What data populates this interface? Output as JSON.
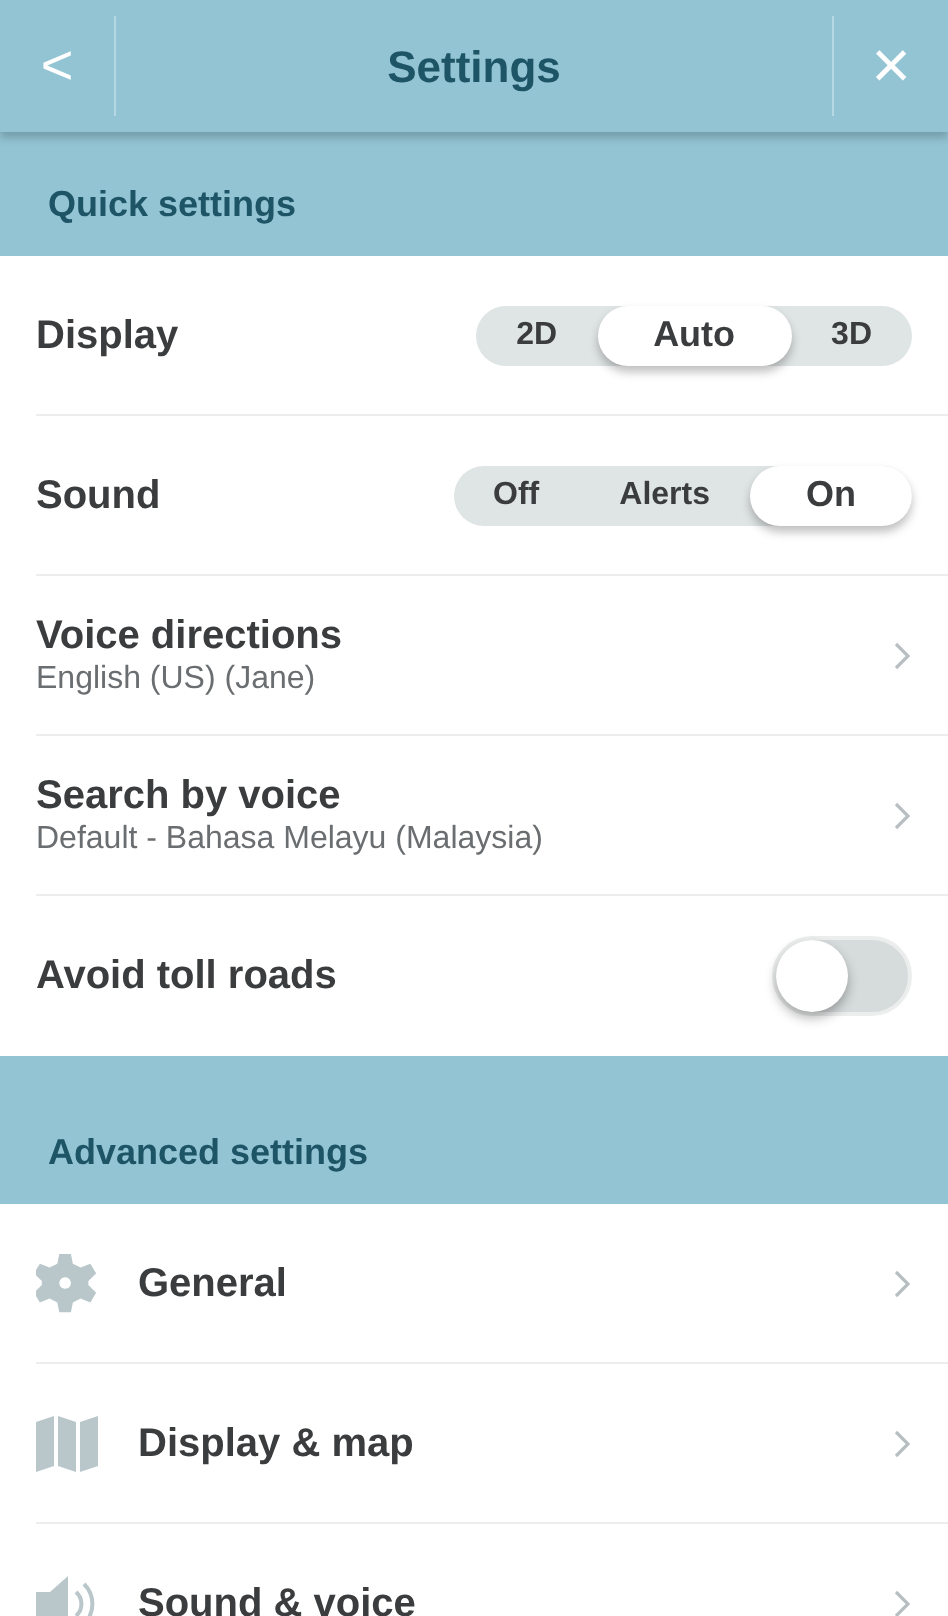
{
  "header": {
    "title": "Settings",
    "back": "<",
    "close": "×"
  },
  "quick_settings": {
    "title": "Quick settings",
    "rows": [
      {
        "kind": "segmented",
        "label": "Display",
        "options": [
          {
            "label": "2D",
            "selected": false
          },
          {
            "label": "Auto",
            "selected": true
          },
          {
            "label": "3D",
            "selected": false
          }
        ]
      },
      {
        "kind": "segmented",
        "label": "Sound",
        "options": [
          {
            "label": "Off",
            "selected": false
          },
          {
            "label": "Alerts",
            "selected": false
          },
          {
            "label": "On",
            "selected": true
          }
        ]
      },
      {
        "kind": "link",
        "label": "Voice directions",
        "value": "English (US) (Jane)"
      },
      {
        "kind": "link",
        "label": "Search by voice",
        "value": "Default - Bahasa Melayu (Malaysia)"
      },
      {
        "kind": "toggle",
        "label": "Avoid toll roads",
        "on": false
      }
    ]
  },
  "advanced_settings": {
    "title": "Advanced settings",
    "items": [
      {
        "kind": "gear",
        "label": "General"
      },
      {
        "kind": "map",
        "label": "Display & map"
      },
      {
        "kind": "speaker",
        "label": "Sound & voice"
      }
    ]
  }
}
